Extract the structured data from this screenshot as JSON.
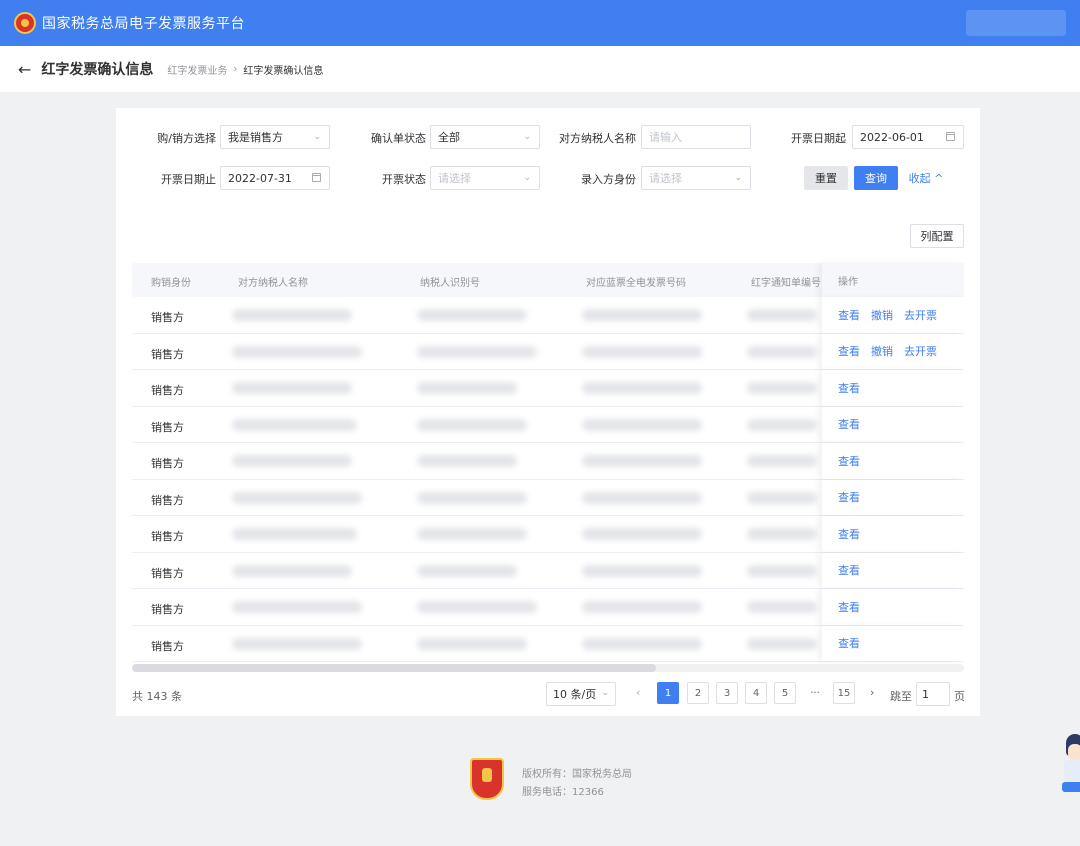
{
  "header": {
    "title": "国家税务总局电子发票服务平台"
  },
  "subheader": {
    "page_title": "红字发票确认信息",
    "breadcrumb_parent": "红字发票业务",
    "breadcrumb_sep": "›",
    "breadcrumb_current": "红字发票确认信息"
  },
  "filters": {
    "buyer_seller_label": "购/销方选择",
    "buyer_seller_value": "我是销售方",
    "confirm_status_label": "确认单状态",
    "confirm_status_value": "全部",
    "counterparty_label": "对方纳税人名称",
    "counterparty_placeholder": "请输入",
    "date_start_label": "开票日期起",
    "date_start_value": "2022-06-01",
    "date_end_label": "开票日期止",
    "date_end_value": "2022-07-31",
    "invoice_status_label": "开票状态",
    "invoice_status_placeholder": "请选择",
    "entry_role_label": "录入方身份",
    "entry_role_placeholder": "请选择",
    "reset_label": "重置",
    "query_label": "查询",
    "collapse_label": "收起 ^"
  },
  "toolbar": {
    "column_config_label": "列配置"
  },
  "table": {
    "headers": [
      "购销身份",
      "对方纳税人名称",
      "纳税人识别号",
      "对应蓝票全电发票号码",
      "红字通知单编号",
      "操作"
    ],
    "rows": [
      {
        "role": "销售方",
        "actions": [
          "查看",
          "撤销",
          "去开票"
        ]
      },
      {
        "role": "销售方",
        "actions": [
          "查看",
          "撤销",
          "去开票"
        ]
      },
      {
        "role": "销售方",
        "actions": [
          "查看"
        ]
      },
      {
        "role": "销售方",
        "actions": [
          "查看"
        ]
      },
      {
        "role": "销售方",
        "actions": [
          "查看"
        ]
      },
      {
        "role": "销售方",
        "actions": [
          "查看"
        ]
      },
      {
        "role": "销售方",
        "actions": [
          "查看"
        ]
      },
      {
        "role": "销售方",
        "actions": [
          "查看"
        ]
      },
      {
        "role": "销售方",
        "actions": [
          "查看"
        ]
      },
      {
        "role": "销售方",
        "actions": [
          "查看"
        ]
      }
    ]
  },
  "pagination": {
    "total_text": "共 143 条",
    "page_size": "10 条/页",
    "pages": [
      "1",
      "2",
      "3",
      "4",
      "5",
      "···",
      "15"
    ],
    "current_page": "1",
    "prev": "‹",
    "next": "›",
    "jump_label": "跳至",
    "jump_value": "1",
    "jump_suffix": "页"
  },
  "footer": {
    "copyright": "版权所有：国家税务总局",
    "phone": "服务电话：12366"
  },
  "colors": {
    "primary": "#3f7ff0",
    "background": "#f0f1f3"
  }
}
